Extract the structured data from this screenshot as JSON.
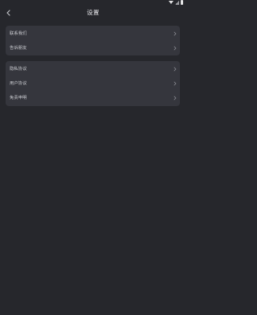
{
  "header": {
    "title": "设置"
  },
  "groups": [
    {
      "items": [
        {
          "label": "联系我们"
        },
        {
          "label": "告诉朋友"
        }
      ]
    },
    {
      "items": [
        {
          "label": "隐私协议"
        },
        {
          "label": "用户协议"
        },
        {
          "label": "免责申明"
        }
      ]
    }
  ],
  "icons": {
    "back": "chevron-left-icon",
    "row": "chevron-right-icon",
    "status": [
      "wifi-icon",
      "signal-icon",
      "battery-icon"
    ]
  },
  "colors": {
    "background": "#26272c",
    "card": "#35363d",
    "text": "#d3d4d9",
    "chevron": "#8e8f96"
  }
}
